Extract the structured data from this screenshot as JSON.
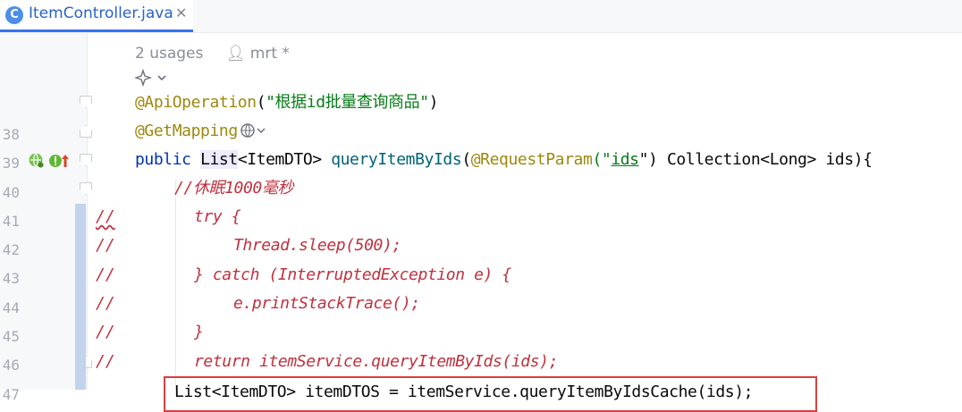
{
  "tab": {
    "icon_letter": "C",
    "title": "ItemController.java",
    "close_glyph": "✕"
  },
  "inlay": {
    "usages": "2 usages",
    "author": "mrt *"
  },
  "line_numbers": [
    "38",
    "39",
    "40",
    "41",
    "42",
    "43",
    "44",
    "45",
    "46",
    "47"
  ],
  "code": {
    "l38_ann": "@ApiOperation",
    "l38_open": "(",
    "l38_str": "\"根据id批量查询商品\"",
    "l38_close": ")",
    "l39_ann": "@GetMapping",
    "l40_public": "public ",
    "l40_list": "List",
    "l40_type": "<ItemDTO> ",
    "l40_method": "queryItemByIds",
    "l40_paren": "(",
    "l40_ann": "@RequestParam",
    "l40_q1": "(\"",
    "l40_ids": "ids",
    "l40_q2": "\") ",
    "l40_rest": "Collection<Long> ids){",
    "l41": "//休眠1000毫秒",
    "l42": "try {",
    "l43": "Thread.sleep(500);",
    "l44": "} catch (InterruptedException e) {",
    "l45": "e.printStackTrace();",
    "l46": "}",
    "l47": "return itemService.queryItemByIds(ids);",
    "l48": "List<ItemDTO> itemDTOS = itemService.queryItemByIdsCache(ids);"
  },
  "comment_marker": "//",
  "colors": {
    "annotation": "#9e880d",
    "string": "#067d17",
    "keyword": "#0033b3",
    "method": "#00627a",
    "commented": "#c0313e",
    "highlight_box": "#d93f3f"
  }
}
